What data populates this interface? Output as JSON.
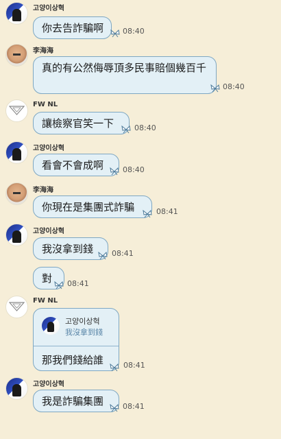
{
  "messages": [
    {
      "sender": "고양이상혁",
      "text": "你去告詐騙啊",
      "time": "08:40"
    },
    {
      "sender": "李海海",
      "text": "真的有公然侮辱頂多民事賠個幾百千",
      "time": "08:40"
    },
    {
      "sender": "FW NL",
      "text": "讓檢察官笑一下",
      "time": "08:40"
    },
    {
      "sender": "고양이상혁",
      "text": "看會不會成啊",
      "time": "08:40"
    },
    {
      "sender": "李海海",
      "text": "你現在是集團式詐騙",
      "time": "08:41"
    },
    {
      "sender": "고양이상혁",
      "text": "我沒拿到錢",
      "time": "08:41"
    },
    {
      "sender": "",
      "text": "對",
      "time": "08:41"
    },
    {
      "sender": "FW NL",
      "quote_name": "고양이상혁",
      "quote_text": "我沒拿到錢",
      "text": "那我們錢給誰",
      "time": "08:41"
    },
    {
      "sender": "고양이상혁",
      "text": "我是詐騙集團",
      "time": "08:41"
    }
  ],
  "colors": {
    "background": "#f6eed8",
    "bubble": "#e3f0f6",
    "bubble_border": "#7ea7c2"
  },
  "icons": {
    "bubble_decoration": "butterfly-icon",
    "fw_avatar": "triangle-logo-icon"
  }
}
